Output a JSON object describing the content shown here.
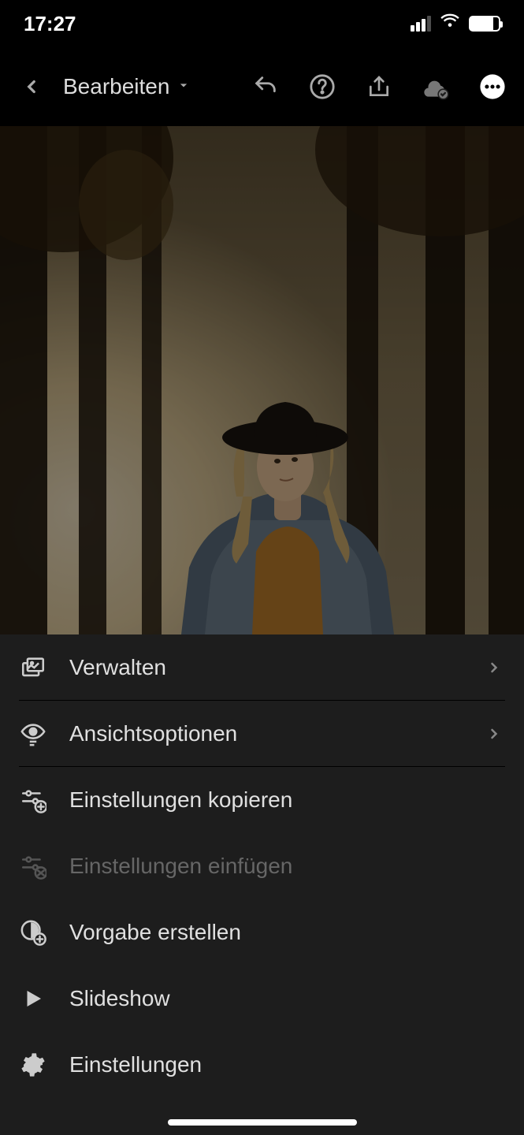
{
  "status": {
    "time": "17:27"
  },
  "header": {
    "title": "Bearbeiten"
  },
  "menu": {
    "items": [
      {
        "label": "Verwalten",
        "icon": "organize-icon",
        "chevron": true,
        "disabled": false
      },
      {
        "label": "Ansichtsoptionen",
        "icon": "eye-options-icon",
        "chevron": true,
        "disabled": false
      },
      {
        "label": "Einstellungen kopieren",
        "icon": "sliders-copy-icon",
        "chevron": false,
        "disabled": false
      },
      {
        "label": "Einstellungen einfügen",
        "icon": "sliders-paste-icon",
        "chevron": false,
        "disabled": true
      },
      {
        "label": "Vorgabe erstellen",
        "icon": "preset-create-icon",
        "chevron": false,
        "disabled": false
      },
      {
        "label": "Slideshow",
        "icon": "play-icon",
        "chevron": false,
        "disabled": false
      },
      {
        "label": "Einstellungen",
        "icon": "gear-icon",
        "chevron": false,
        "disabled": false
      }
    ]
  }
}
